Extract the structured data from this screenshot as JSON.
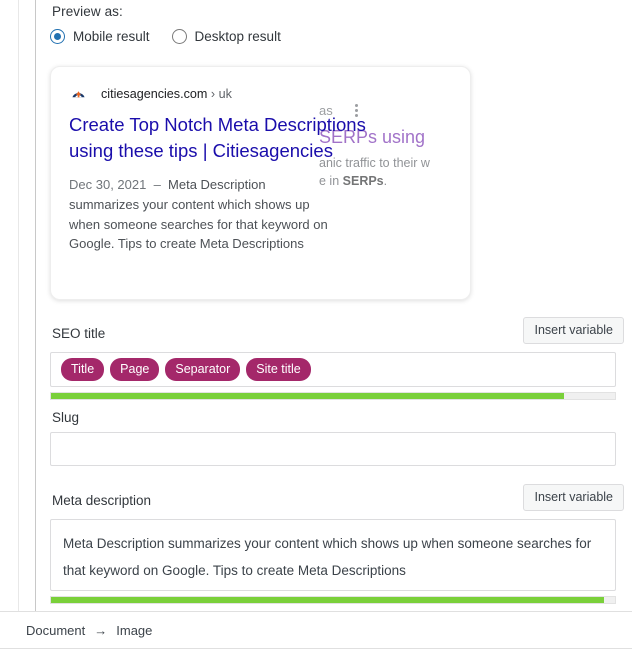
{
  "preview": {
    "section_label": "Preview as:",
    "options": [
      {
        "label": "Mobile result",
        "checked": true
      },
      {
        "label": "Desktop result",
        "checked": false
      }
    ],
    "card": {
      "favicon_name": "citiesagencies-favicon",
      "domain": "citiesagencies.com",
      "breadcrumb": "› uk",
      "title": "Create Top Notch Meta Descriptions using these tips | Citiesagencies",
      "date": "Dec 30, 2021",
      "dash": "—",
      "description": "Meta Description summarizes your content which shows up when someone searches for that keyword on Google. Tips to create Meta Descriptions",
      "background_bleed": {
        "fragment_top": "as",
        "fragment_title": "SERPs using",
        "fragment_line1": "anic traffic to their w",
        "fragment_line2_pre": "e in ",
        "fragment_line2_bold": "SERPs",
        "fragment_line2_post": "."
      }
    }
  },
  "seo_title": {
    "label": "SEO title",
    "insert_variable_label": "Insert variable",
    "pills": [
      "Title",
      "Page",
      "Separator",
      "Site title"
    ],
    "progress_percent": 91
  },
  "slug": {
    "label": "Slug",
    "value": "",
    "placeholder": ""
  },
  "meta_description": {
    "label": "Meta description",
    "insert_variable_label": "Insert variable",
    "value": "Meta Description summarizes your content which shows up when someone searches for that keyword on Google. Tips to create Meta Descriptions",
    "progress_percent": 98
  },
  "status_bar": {
    "items": [
      "Document",
      "Image"
    ],
    "separator": "→"
  },
  "colors": {
    "accent_blue": "#2271b1",
    "link_blue": "#1a0dab",
    "pill_magenta": "#a4286a",
    "progress_green": "#7ad03a",
    "bleed_purple": "#681da8"
  }
}
